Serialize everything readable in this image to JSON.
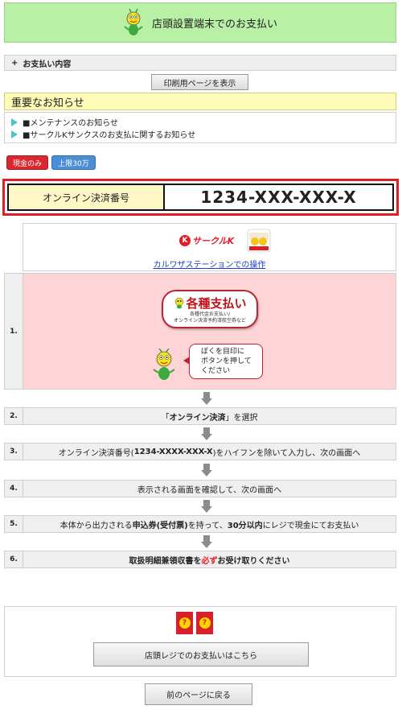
{
  "header": {
    "title": "店頭設置端末でのお支払い"
  },
  "payment_details": {
    "plus": "+",
    "label": "お支払い内容"
  },
  "print_button": "印刷用ページを表示",
  "notice": {
    "title": "重要なお知らせ",
    "items": [
      "■メンテナンスのお知らせ",
      "■サークルKサンクスのお支払に関するお知らせ"
    ]
  },
  "badges": {
    "cash_only": "現金のみ",
    "limit": "上限30万"
  },
  "payment_number": {
    "label": "オンライン決済番号",
    "value": "1234-XXX-XXX-X"
  },
  "store": {
    "circle_k_mark": "K",
    "circle_k_name": "サークルK",
    "link": "カルワザステーションでの操作"
  },
  "steps": [
    {
      "num": "1.",
      "button_title": "各種支払い",
      "button_sub1": "各種代金お支払い/",
      "button_sub2": "オンライン決済予約済航空券など",
      "bubble_line1": "ぼくを目印に",
      "bubble_line2": "ボタンを押して",
      "bubble_line3": "ください"
    },
    {
      "num": "2.",
      "pre": "「",
      "strong": "オンライン決済",
      "post": "」を選択"
    },
    {
      "num": "3.",
      "pre": "オンライン決済番号(",
      "strong": "1234-XXXX-XXX-X",
      "post": ")をハイフンを除いて入力し、次の画面へ"
    },
    {
      "num": "4.",
      "text": "表示される画面を確認して、次の画面へ"
    },
    {
      "num": "5.",
      "a": "本体から出力される",
      "b": "申込券(受付票)",
      "c": "を持って、",
      "d": "30分以内",
      "e": "にレジで現金にてお支払い"
    },
    {
      "num": "6.",
      "a": "取扱明細兼領収書を",
      "b": "必ず",
      "c": "お受け取りください"
    }
  ],
  "daily": {
    "logo_mark": "?",
    "store_pay_button": "店頭レジでのお支払いはこちら"
  },
  "back_button": "前のページに戻る"
}
